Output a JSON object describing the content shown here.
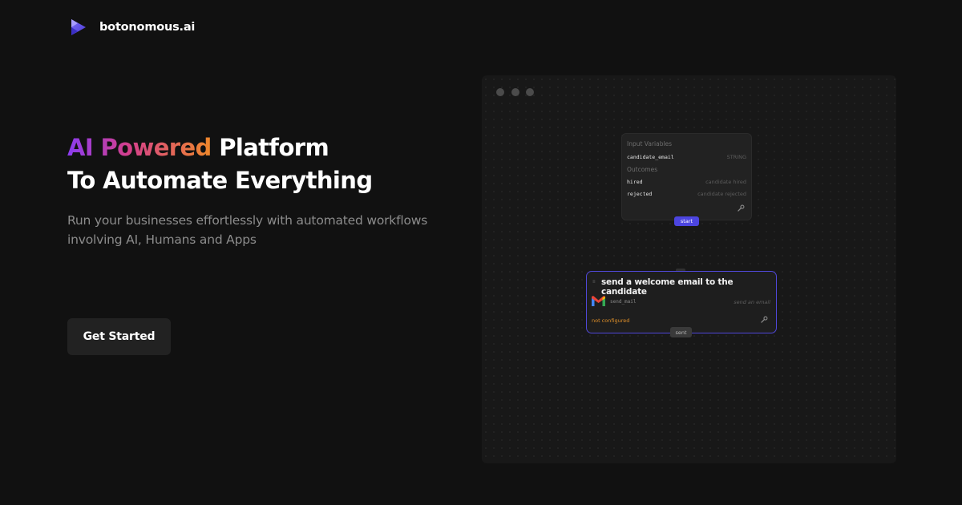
{
  "brand": {
    "name": "botonomous.ai",
    "logo_icon": "play-triangle-logo-icon"
  },
  "hero": {
    "title_gradient": "AI Powered",
    "title_rest": " Platform",
    "title_line2": "To Automate Everything",
    "subtitle_line1": "Run your businesses effortlessly with automated workflows",
    "subtitle_line2": "involving AI, Humans and Apps",
    "gradient_colors": [
      "#8b3cf0",
      "#d43f8d",
      "#f0892a"
    ]
  },
  "cta": {
    "label": "Get Started"
  },
  "workflow": {
    "start_node": {
      "inputs_heading": "Input Variables",
      "inputs": [
        {
          "name": "candidate_email",
          "type": "STRING"
        }
      ],
      "outcomes_heading": "Outcomes",
      "outcomes": [
        {
          "name": "hired",
          "description": "candidate hired"
        },
        {
          "name": "rejected",
          "description": "candidate rejected"
        }
      ],
      "settings_icon": "wrench-icon",
      "badge": "start",
      "badge_color": "#4c45e0"
    },
    "action_node": {
      "title": "send a welcome email to the candidate",
      "app_icon": "gmail-icon",
      "action_key": "send_mail",
      "action_description": "send an email",
      "status": "not configured",
      "status_color": "#e0902a",
      "settings_icon": "wrench-icon",
      "outcome_badge": "sent",
      "border_color": "#5048d8"
    }
  }
}
